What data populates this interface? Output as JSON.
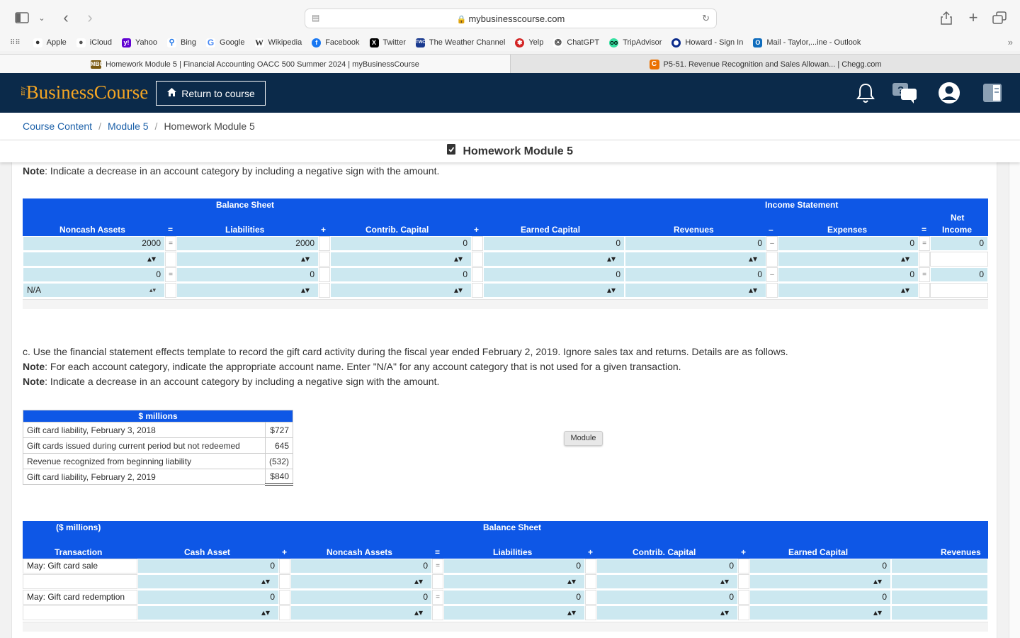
{
  "browser": {
    "url": "mybusinesscourse.com",
    "favorites": [
      {
        "label": "Apple",
        "icon": "apple-icon",
        "color": "#333333"
      },
      {
        "label": "iCloud",
        "icon": "apple-icon",
        "color": "#333333"
      },
      {
        "label": "Yahoo",
        "icon": "yahoo-icon",
        "color": "#6001d2"
      },
      {
        "label": "Bing",
        "icon": "search-icon",
        "color": "#1a73e8"
      },
      {
        "label": "Google",
        "icon": "google-icon",
        "color": "#4285f4"
      },
      {
        "label": "Wikipedia",
        "icon": "wikipedia-icon",
        "color": "#444444"
      },
      {
        "label": "Facebook",
        "icon": "facebook-icon",
        "color": "#1877f2"
      },
      {
        "label": "Twitter",
        "icon": "x-icon",
        "color": "#000000"
      },
      {
        "label": "The Weather Channel",
        "icon": "weather-icon",
        "color": "#1a3a8f"
      },
      {
        "label": "Yelp",
        "icon": "yelp-icon",
        "color": "#d32323"
      },
      {
        "label": "ChatGPT",
        "icon": "chatgpt-icon",
        "color": "#555555"
      },
      {
        "label": "TripAdvisor",
        "icon": "tripadvisor-icon",
        "color": "#34e0a1"
      },
      {
        "label": "Howard - Sign In",
        "icon": "howard-icon",
        "color": "#0a2a8a"
      },
      {
        "label": "Mail - Taylor,...ine - Outlook",
        "icon": "outlook-icon",
        "color": "#0f6cbd"
      }
    ],
    "tabs": [
      {
        "label": "Homework Module 5 | Financial Accounting OACC 500 Summer 2024 | myBusinessCourse",
        "icon_text": "MBC"
      },
      {
        "label": "P5-51.  Revenue Recognition and Sales Allowan... | Chegg.com",
        "icon_text": "C"
      }
    ]
  },
  "header": {
    "logo_my": "my",
    "logo_text": "BusinessCourse",
    "return_label": "Return to course"
  },
  "breadcrumb": {
    "items": [
      "Course Content",
      "Module 5"
    ],
    "current": "Homework Module 5"
  },
  "page_title": "Homework Module 5",
  "top_note": {
    "bold": "Note",
    "text": ": Indicate a decrease in an account category by including a negative sign with the amount."
  },
  "table1": {
    "group_headers": {
      "balance": "Balance Sheet",
      "income": "Income Statement"
    },
    "columns": [
      "Noncash Assets",
      "=",
      "Liabilities",
      "+",
      "Contrib. Capital",
      "+",
      "Earned Capital",
      "Revenues",
      "–",
      "Expenses",
      "=",
      "Net Income"
    ],
    "net_top": "Net",
    "net_bottom": "Income",
    "rows": [
      [
        "2000",
        "=",
        "2000",
        "",
        "0",
        "",
        "0",
        "0",
        "–",
        "0",
        "=",
        "0"
      ],
      [
        "",
        "",
        "",
        "",
        "",
        "",
        "",
        "",
        "",
        "",
        "",
        ""
      ],
      [
        "0",
        "=",
        "0",
        "",
        "0",
        "",
        "0",
        "0",
        "–",
        "0",
        "=",
        "0"
      ],
      [
        "N/A",
        "",
        "",
        "",
        "",
        "",
        "",
        "",
        "",
        "",
        "",
        ""
      ]
    ]
  },
  "part_c": {
    "text": "c. Use the financial statement effects template to record the gift card activity during the fiscal year ended February 2, 2019. Ignore sales tax and returns. Details are as follows.",
    "note1_bold": "Note",
    "note1": ": For each account category, indicate the appropriate account name. Enter \"N/A\" for any account category that is not used for a given transaction.",
    "note2_bold": "Note",
    "note2": ": Indicate a decrease in an account category by including a negative sign with the amount."
  },
  "gift_table": {
    "header": "$ millions",
    "rows": [
      {
        "label": "Gift card liability, February 3, 2018",
        "value": "$727"
      },
      {
        "label": "Gift cards issued during current period but not redeemed",
        "value": "645"
      },
      {
        "label": "Revenue recognized from beginning liability",
        "value": "(532)"
      },
      {
        "label": "Gift card liability, February 2, 2019",
        "value": "$840"
      }
    ]
  },
  "tooltip": "Module",
  "table2": {
    "group_headers": {
      "millions": "($ millions)",
      "balance": "Balance Sheet"
    },
    "columns": [
      "Transaction",
      "Cash Asset",
      "+",
      "Noncash Assets",
      "=",
      "Liabilities",
      "+",
      "Contrib. Capital",
      "+",
      "Earned Capital",
      "Revenues"
    ],
    "rows": [
      {
        "label": "May: Gift card sale",
        "values": [
          "0",
          "",
          "0",
          "=",
          "0",
          "",
          "0",
          "",
          "0",
          ""
        ]
      },
      {
        "label": "",
        "values": [
          "",
          "",
          "",
          "",
          "",
          "",
          "",
          "",
          "",
          ""
        ]
      },
      {
        "label": "May: Gift card redemption",
        "values": [
          "0",
          "",
          "0",
          "=",
          "0",
          "",
          "0",
          "",
          "0",
          ""
        ]
      },
      {
        "label": "",
        "values": [
          "",
          "",
          "",
          "",
          "",
          "",
          "",
          "",
          "",
          ""
        ]
      }
    ]
  }
}
